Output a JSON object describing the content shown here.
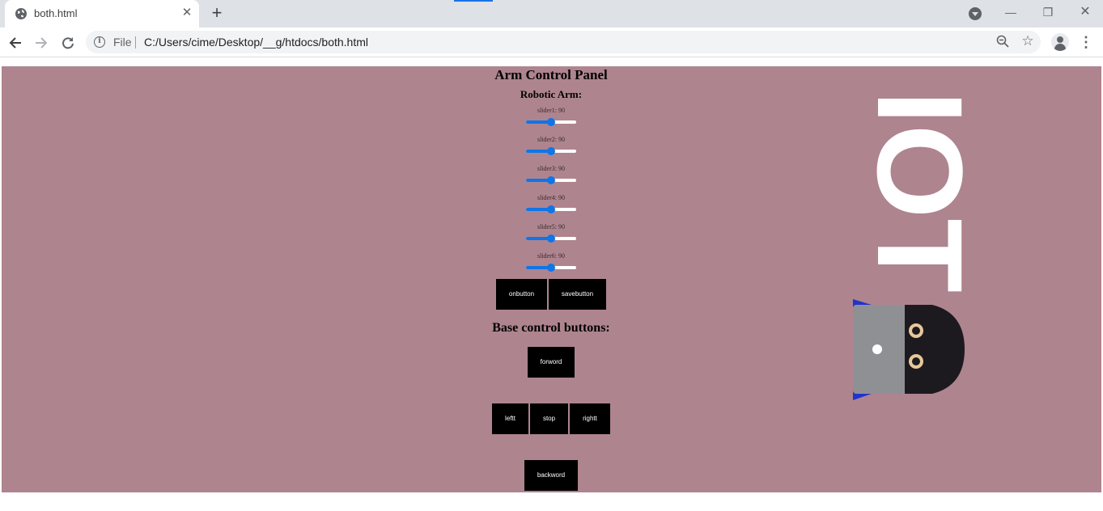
{
  "browser": {
    "tab_title": "both.html",
    "tab_close": "✕",
    "new_tab": "+",
    "scheme": "File",
    "url": "C:/Users/cime/Desktop/__g/htdocs/both.html",
    "icons": {
      "favicon": "globe-icon",
      "back": "arrow-left-icon",
      "forward": "arrow-right-icon",
      "reload": "reload-icon",
      "info": "info-icon",
      "zoom": "zoom-out-icon",
      "bookmark": "star-icon",
      "profile": "avatar-icon",
      "menu": "kebab-menu-icon"
    },
    "window_controls": {
      "minimize": "—",
      "maximize": "❐",
      "close": "✕"
    },
    "colors": {
      "tabstrip": "#dee1e6",
      "omnibox": "#f1f3f4",
      "accent": "#1a73e8"
    }
  },
  "page": {
    "background": "#ae848f",
    "title": "Arm Control Panel",
    "arm_heading": "Robotic Arm:",
    "sliders": [
      {
        "label": "slider1: 90",
        "value": 90,
        "min": 0,
        "max": 180
      },
      {
        "label": "slider2: 90",
        "value": 90,
        "min": 0,
        "max": 180
      },
      {
        "label": "slider3: 90",
        "value": 90,
        "min": 0,
        "max": 180
      },
      {
        "label": "slider4: 90",
        "value": 90,
        "min": 0,
        "max": 180
      },
      {
        "label": "slider5: 90",
        "value": 90,
        "min": 0,
        "max": 180
      },
      {
        "label": "slider6: 90",
        "value": 90,
        "min": 0,
        "max": 180
      }
    ],
    "slider_color": "#0f75e8",
    "on_button": "onbutton",
    "save_button": "savebutton",
    "base_heading": "Base control buttons:",
    "forward_button": "forword",
    "left_button": "leftt",
    "stop_button": "stop",
    "right_button": "rightt",
    "backward_button": "backword",
    "logo_text": "IOT",
    "logo_icon": "robot-mascot-icon"
  }
}
